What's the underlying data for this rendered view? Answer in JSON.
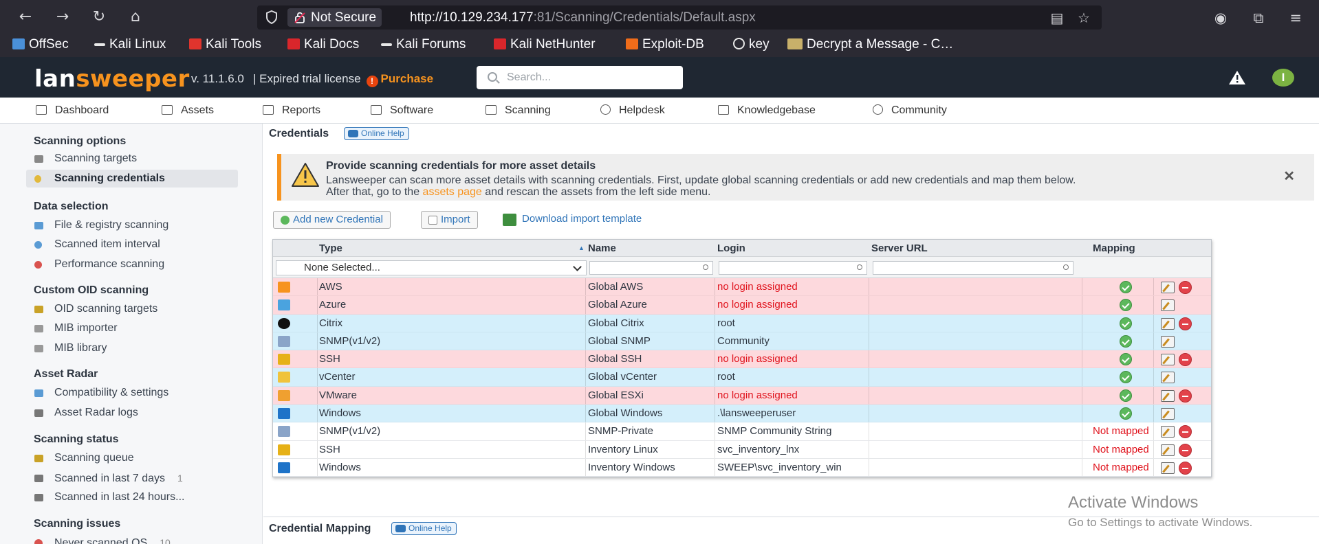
{
  "browser": {
    "security_label": "Not Secure",
    "url_host": "http://10.129.234.177",
    "url_rest": ":81/Scanning/Credentials/Default.aspx"
  },
  "bookmarks": [
    {
      "label": "OffSec",
      "icon": "offsec-icon",
      "color": "#4a90d9"
    },
    {
      "label": "Kali Linux",
      "icon": "kali-dragon-icon",
      "color": "#e8e8e8"
    },
    {
      "label": "Kali Tools",
      "icon": "kali-tools-icon",
      "color": "#e0342d"
    },
    {
      "label": "Kali Docs",
      "icon": "kali-docs-icon",
      "color": "#d9262b"
    },
    {
      "label": "Kali Forums",
      "icon": "kali-forums-icon",
      "color": "#e8e8e8"
    },
    {
      "label": "Kali NetHunter",
      "icon": "nethunter-icon",
      "color": "#d9262b"
    },
    {
      "label": "Exploit-DB",
      "icon": "exploit-db-icon",
      "color": "#ef6c1a"
    },
    {
      "label": "key",
      "icon": "globe-icon",
      "color": "#e8e8e8"
    },
    {
      "label": "Decrypt a Message - C…",
      "icon": "envelope-icon",
      "color": "#c8b06a"
    }
  ],
  "header": {
    "logo_a": "lan",
    "logo_b": "sweeper",
    "version": "v. 11.1.6.0",
    "trial": "| Expired trial license",
    "purchase": "Purchase",
    "search_placeholder": "Search...",
    "user_initial": "I",
    "accent": "#f7931e"
  },
  "nav": [
    {
      "label": "Dashboard",
      "icon": "dashboard-icon"
    },
    {
      "label": "Assets",
      "icon": "monitor-icon"
    },
    {
      "label": "Reports",
      "icon": "reports-icon"
    },
    {
      "label": "Software",
      "icon": "software-icon"
    },
    {
      "label": "Scanning",
      "icon": "scanning-icon"
    },
    {
      "label": "Helpdesk",
      "icon": "help-icon"
    },
    {
      "label": "Knowledgebase",
      "icon": "knowledgebase-icon"
    },
    {
      "label": "Community",
      "icon": "community-icon"
    }
  ],
  "sidebar": {
    "sections": [
      {
        "title": "Scanning options",
        "items": [
          {
            "label": "Scanning targets",
            "icon": "key-icon",
            "color": "#888888"
          },
          {
            "label": "Scanning credentials",
            "icon": "credential-icon",
            "color": "#e2b93b",
            "active": true
          }
        ]
      },
      {
        "title": "Data selection",
        "items": [
          {
            "label": "File & registry scanning",
            "icon": "file-scan-icon",
            "color": "#5a9bd4"
          },
          {
            "label": "Scanned item interval",
            "icon": "interval-icon",
            "color": "#5a9bd4"
          },
          {
            "label": "Performance scanning",
            "icon": "performance-icon",
            "color": "#d9534f"
          }
        ]
      },
      {
        "title": "Custom OID scanning",
        "items": [
          {
            "label": "OID scanning targets",
            "icon": "oid-icon",
            "color": "#c9a227"
          },
          {
            "label": "MIB importer",
            "icon": "mib-importer-icon",
            "color": "#999999"
          },
          {
            "label": "MIB library",
            "icon": "mib-library-icon",
            "color": "#999999"
          }
        ]
      },
      {
        "title": "Asset Radar",
        "items": [
          {
            "label": "Compatibility & settings",
            "icon": "radar-settings-icon",
            "color": "#5a9bd4"
          },
          {
            "label": "Asset Radar logs",
            "icon": "log-icon",
            "color": "#777777"
          }
        ]
      },
      {
        "title": "Scanning status",
        "items": [
          {
            "label": "Scanning queue",
            "icon": "queue-icon",
            "color": "#c9a227"
          },
          {
            "label": "Scanned in last 7 days",
            "icon": "calendar-icon",
            "color": "#777777",
            "count": "1"
          },
          {
            "label": "Scanned in last 24 hours...",
            "icon": "calendar-icon",
            "color": "#777777"
          }
        ]
      },
      {
        "title": "Scanning issues",
        "items": [
          {
            "label": "Never scanned OS",
            "icon": "error-icon",
            "color": "#d9534f",
            "count": "10"
          }
        ]
      }
    ]
  },
  "main": {
    "title": "Credentials",
    "online_help": "Online Help",
    "banner": {
      "title": "Provide scanning credentials for more asset details",
      "text_1": "Lansweeper can scan more asset details with scanning credentials. First, update global scanning credentials or add new credentials and map them below.",
      "text_2a": "After that, go to the",
      "link": "assets page",
      "text_2b": "and rescan the assets from the left side menu."
    },
    "buttons": {
      "add": "Add new Credential",
      "import": "Import",
      "download": "Download import template"
    },
    "columns": {
      "type": "Type",
      "name": "Name",
      "login": "Login",
      "server": "Server URL",
      "mapping": "Mapping"
    },
    "filter_type": "None Selected...",
    "rows": [
      {
        "type": "AWS",
        "name": "Global AWS",
        "login": "no login assigned",
        "missing": true,
        "mapped": true,
        "deletable": true,
        "icon": "aws-icon",
        "icon_color": "#f7931e",
        "tone": "red"
      },
      {
        "type": "Azure",
        "name": "Global Azure",
        "login": "no login assigned",
        "missing": true,
        "mapped": true,
        "deletable": false,
        "icon": "azure-icon",
        "icon_color": "#4aa3df",
        "tone": "red"
      },
      {
        "type": "Citrix",
        "name": "Global Citrix",
        "login": "root",
        "missing": false,
        "mapped": true,
        "deletable": true,
        "icon": "citrix-icon",
        "icon_color": "#111111",
        "tone": "blue"
      },
      {
        "type": "SNMP(v1/v2)",
        "name": "Global SNMP",
        "login": "Community",
        "missing": false,
        "mapped": true,
        "deletable": false,
        "icon": "snmp-icon",
        "icon_color": "#8aa4c8",
        "tone": "blue"
      },
      {
        "type": "SSH",
        "name": "Global SSH",
        "login": "no login assigned",
        "missing": true,
        "mapped": true,
        "deletable": true,
        "icon": "linux-icon",
        "icon_color": "#e6b117",
        "tone": "red"
      },
      {
        "type": "vCenter",
        "name": "Global vCenter",
        "login": "root",
        "missing": false,
        "mapped": true,
        "deletable": false,
        "icon": "vcenter-icon",
        "icon_color": "#f0c33c",
        "tone": "blue"
      },
      {
        "type": "VMware",
        "name": "Global ESXi",
        "login": "no login assigned",
        "missing": true,
        "mapped": true,
        "deletable": true,
        "icon": "vmware-icon",
        "icon_color": "#f0a030",
        "tone": "red"
      },
      {
        "type": "Windows",
        "name": "Global Windows",
        "login": ".\\lansweeperuser",
        "missing": false,
        "mapped": true,
        "deletable": false,
        "icon": "windows-icon",
        "icon_color": "#1e73c8",
        "tone": "blue"
      },
      {
        "type": "SNMP(v1/v2)",
        "name": "SNMP-Private",
        "login": "SNMP Community String",
        "missing": false,
        "mapped": false,
        "deletable": true,
        "icon": "snmp-icon",
        "icon_color": "#8aa4c8",
        "tone": "white"
      },
      {
        "type": "SSH",
        "name": "Inventory Linux",
        "login": "svc_inventory_lnx",
        "missing": false,
        "mapped": false,
        "deletable": true,
        "icon": "linux-icon",
        "icon_color": "#e6b117",
        "tone": "white"
      },
      {
        "type": "Windows",
        "name": "Inventory Windows",
        "login": "SWEEP\\svc_inventory_win",
        "missing": false,
        "mapped": false,
        "deletable": true,
        "icon": "windows-icon",
        "icon_color": "#1e73c8",
        "tone": "white"
      }
    ],
    "not_mapped_label": "Not mapped",
    "mapping_title": "Credential Mapping"
  },
  "watermark": {
    "line1": "Activate Windows",
    "line2": "Go to Settings to activate Windows."
  }
}
